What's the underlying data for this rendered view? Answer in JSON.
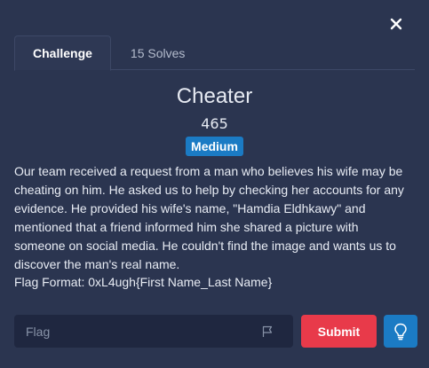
{
  "tabs": [
    {
      "label": "Challenge",
      "active": true
    },
    {
      "label": "15 Solves",
      "active": false
    }
  ],
  "challenge": {
    "title": "Cheater",
    "points": "465",
    "difficulty": "Medium",
    "description": "Our team received a request from a man who believes his wife may be cheating on him. He asked us to help by checking her accounts for any evidence. He provided his wife's name, \"Hamdia Eldhkawy\" and mentioned that a friend informed him she shared a picture with someone on social media. He couldn't find the image and wants us to discover the man's real name.",
    "flag_format": "Flag Format: 0xL4ugh{First Name_Last Name}"
  },
  "form": {
    "flag_placeholder": "Flag",
    "flag_value": "",
    "submit_label": "Submit"
  },
  "icons": {
    "close": "close-icon",
    "flag": "flag-icon",
    "hint": "lightbulb-icon"
  },
  "colors": {
    "background": "#2b3550",
    "submit": "#e83a4a",
    "accent": "#1b7bc4",
    "input_bg": "#1f2740"
  }
}
